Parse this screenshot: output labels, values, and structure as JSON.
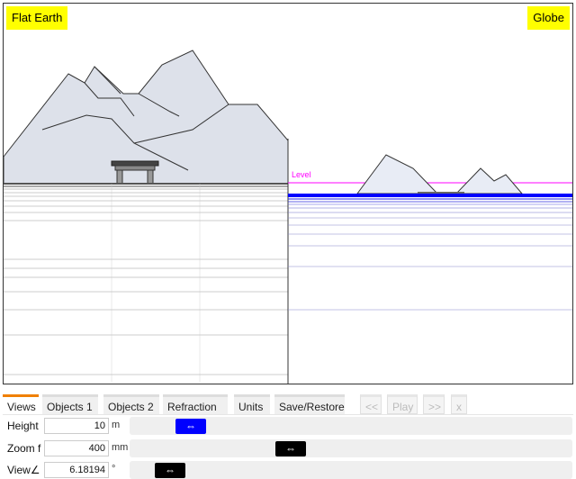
{
  "scene": {
    "left_label": "Flat Earth",
    "right_label": "Globe",
    "level_text": "Level"
  },
  "tabs": [
    {
      "label": "Views",
      "active": true
    },
    {
      "label": "Objects 1",
      "active": false
    },
    {
      "label": "Objects 2",
      "active": false
    },
    {
      "label": "Refraction",
      "active": false
    },
    {
      "label": "Units",
      "active": false
    },
    {
      "label": "Save/Restore",
      "active": false
    },
    {
      "label": "<<",
      "disabled": true
    },
    {
      "label": "Play",
      "disabled": true
    },
    {
      "label": ">>",
      "disabled": true
    },
    {
      "label": "x",
      "disabled": true
    }
  ],
  "controls": {
    "height": {
      "label": "Height",
      "value": "10",
      "unit": "m",
      "slider_fraction": 0.13,
      "handle_color": "#0000ff"
    },
    "zoom": {
      "label": "Zoom f",
      "value": "400",
      "unit": "mm",
      "slider_fraction": 0.36,
      "handle_color": "#000000"
    },
    "view": {
      "label": "View∠",
      "value": "6.18194",
      "unit": "°",
      "slider_fraction": 0.06,
      "handle_color": "#000000"
    }
  },
  "icons": {
    "slider_handle": "⇔"
  },
  "colors": {
    "label_bg": "#ffff00",
    "level_line": "#ff00ff",
    "water": "#0000ff",
    "active_tab": "#f08000",
    "mountain_fill": "#dde1ea"
  }
}
